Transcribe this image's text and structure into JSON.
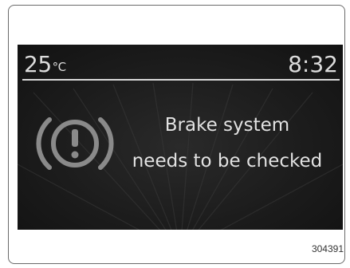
{
  "display": {
    "temperature": "25",
    "temperature_unit": "°C",
    "time": "8:32",
    "message_line1": "Brake system",
    "message_line2": "needs to be checked",
    "icon": "brake-warning-icon"
  },
  "figure_code": "304391",
  "colors": {
    "screen_background": "#1c1c1c",
    "screen_text": "#dcdcdc",
    "icon": "#8a8a8a"
  }
}
